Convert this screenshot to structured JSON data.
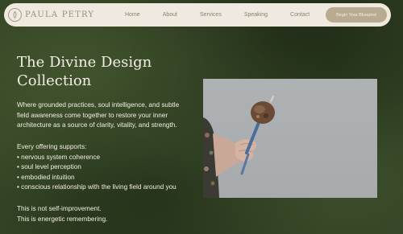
{
  "brand": {
    "name": "PAULA PETRY"
  },
  "nav": {
    "items": [
      {
        "label": "Home"
      },
      {
        "label": "About"
      },
      {
        "label": "Services"
      },
      {
        "label": "Speaking"
      },
      {
        "label": "Contact"
      }
    ],
    "cta": "Begin Your Blueprint"
  },
  "hero": {
    "title_line1": "The Divine Design",
    "title_line2": "Collection",
    "intro": [
      "Where grounded practices, soul intelligence, and subtle",
      "field awareness come together to restore your inner",
      "architecture as a source of clarity, vitality, and strength."
    ],
    "supports_heading": "Every offering supports:",
    "supports": [
      "nervous system coherence",
      "soul level perception",
      "embodied intuition",
      "conscious relationship with the living field around you"
    ],
    "closing": [
      "This is not self-improvement.",
      "This is energetic remembering."
    ]
  },
  "image": {
    "subject": "hand-holding-rattle-photo"
  },
  "colors": {
    "background": "#2f3f22",
    "nav_bg": "#efe9e0",
    "cta_bg": "#b9ab92",
    "text_light": "#f3efe6"
  }
}
